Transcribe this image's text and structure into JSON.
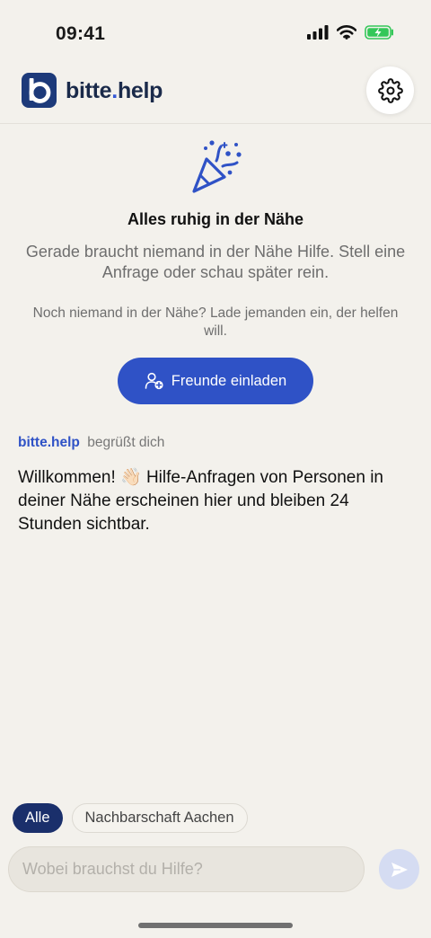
{
  "status_bar": {
    "time": "09:41"
  },
  "header": {
    "brand_name": "bitte",
    "brand_dot": ".",
    "brand_suffix": "help"
  },
  "empty_state": {
    "title": "Alles ruhig in der Nähe",
    "description": "Gerade braucht niemand in der Nähe Hilfe. Stell eine Anfrage oder schau später rein.",
    "invite_hint": "Noch niemand in der Nähe? Lade jemanden ein, der helfen will.",
    "invite_button_label": "Freunde einladen"
  },
  "welcome": {
    "sender": "bitte.help",
    "action": "begrüßt dich",
    "message": "Willkommen! 👋🏻 Hilfe-Anfragen von Personen in deiner Nähe erscheinen hier und bleiben 24 Stunden sichtbar."
  },
  "filters": [
    {
      "label": "Alle",
      "active": true
    },
    {
      "label": "Nachbarschaft Aachen",
      "active": false
    }
  ],
  "composer": {
    "placeholder": "Wobei brauchst du Hilfe?"
  },
  "icons": {
    "settings": "gear-icon",
    "invite": "add-person-icon",
    "send": "send-icon",
    "empty": "party-popper-icon"
  },
  "colors": {
    "accent": "#2f52c6",
    "brand": "#1d3a7a",
    "background": "#f3f1ec",
    "battery": "#34c759"
  }
}
